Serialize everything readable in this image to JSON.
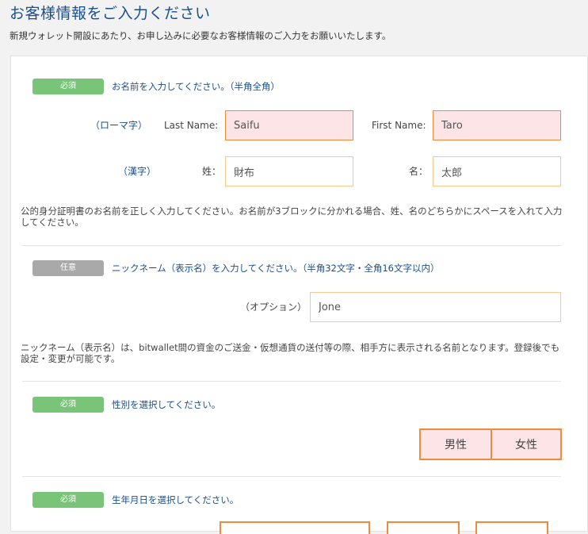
{
  "header": {
    "title": "お客様情報をご入力ください",
    "subtitle": "新規ウォレット開設にあたり、お申し込みに必要なお客様情報のご入力をお願いいたします。"
  },
  "colors": {
    "accent_blue": "#1a4f8f",
    "required_badge": "#7ac47a",
    "optional_badge": "#a9a9a9",
    "input_border": "#f08a3c",
    "input_fill_pink": "#fde4e6"
  },
  "name_section": {
    "badge": "必須",
    "title": "お名前を入力してください。（半角全角）",
    "romaji_label": "（ローマ字）",
    "last_name_label": "Last Name:",
    "last_name_value": "Saifu",
    "first_name_label": "First Name:",
    "first_name_value": "Taro",
    "kanji_label": "（漢字）",
    "sei_label": "姓：",
    "sei_value": "財布",
    "mei_label": "名：",
    "mei_value": "太郎",
    "help": "公的身分証明書のお名前を正しく入力してください。お名前が3ブロックに分かれる場合、姓、名のどちらかにスペースを入れて入力してください。"
  },
  "nickname_section": {
    "badge": "任意",
    "title": "ニックネーム（表示名）を入力してください。（半角32文字・全角16文字以内）",
    "option_label": "（オプション）",
    "value": "Jone",
    "help": "ニックネーム（表示名）は、bitwallet間の資金のご送金・仮想通貨の送付等の際、相手方に表示される名前となります。登録後でも設定・変更が可能です。"
  },
  "gender_section": {
    "badge": "必須",
    "title": "性別を選択してください。",
    "male_label": "男性",
    "female_label": "女性"
  },
  "birthdate_section": {
    "badge": "必須",
    "title": "生年月日を選択してください。"
  }
}
